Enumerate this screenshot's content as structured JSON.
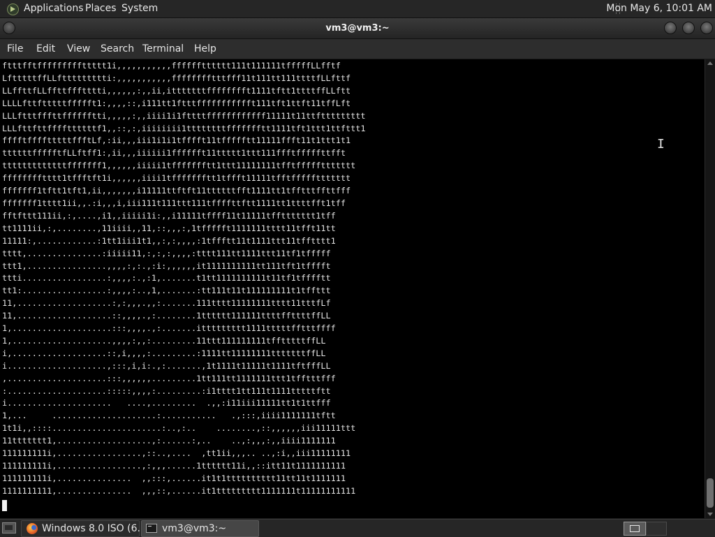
{
  "top_panel": {
    "menus": [
      "Applications",
      "Places",
      "System"
    ],
    "clock": "Mon May  6, 10:01 AM"
  },
  "window": {
    "title": "vm3@vm3:~"
  },
  "terminal_menu": [
    "File",
    "Edit",
    "View",
    "Search",
    "Terminal",
    "Help"
  ],
  "terminal": {
    "lines": [
      "ftttfftfffffffffttttt1i,,,,,,,,,,,fffffftttttt111t111111tfffffLLfftf",
      "LftttttffLLfttttttttti:,,,,,,,,,,,fffffffftttfff11t111tt111ttttfLLfttf",
      "LLffttfLLffttffftttti,,,,,,:,,ii,itttttttfffffffft1111tftt1ttttffLLftt",
      "LLLLfttftttttffffft1:,,,,::,i111tt1ftttffffffffffft111tft1ttft11tffLft",
      "LLLftttfffttfffffftti,,,,,:,,iiii1i1fttttffffffffffff11111t11ttfttttttttt",
      "LLLfttfttffffttttttf1,,::,:,iiiiiiii1ttttttttffffffftt1111tft1ttt1ttfttt1",
      "fffftfffftttttffftLf,:ii,,,iii1i1i1tfffft11tffffftt11111ffft11t1ttt1t1",
      "ttttttffffftfLLftff1:,ii,,,iiiiii1fffffft11ttttt1ttt111ffftfffffttfft",
      "tttttttttttttfffffff1,,,,,,iiiii1tffffffftt1ttt11111111tfftfffffttttttt",
      "fffffffftttt1tffftft1i,,,,,,iiii1tffffffftt1tffft11111tfftfffffttttttt",
      "fffffff1tftt1tft1,ii,,,,,,,i11111ttftft11ttttttfft1111tt1tfftttffttfff",
      "fffffff1tttt1ii,,.:i,,,i,iii111t111ttt111tffffttftt1111tt1ttttfft1tff",
      "fftfttt111ii,:,....,i1,,iiiii1i:,,i11111tffff11t11111tffttttttt1tff",
      "tt1111ii,:,........,11iiii,,11,::,,,:,1tffffft1111111tttt11tfft11tt",
      "11111:,............:1tt1iii1t1,,:,:,,,,:1tffftt11t1111ttt11tfftttt1",
      "tttt,...............:iiiii11,:,:,:,,,,:tttt111tt1111ttt11tf1tfffff",
      "ttt1,................,,,,:,:.,:i:,,,,,,it1111111111tt111tft1tfffft",
      "ttti.................:,,,,:.,:1,.......t1tt1111111111t11tf1tfffftt",
      "tt1:.................:,,,,:..,1,.......:tt111t11t111111111t1tffttt",
      "11,...................:,:,,,.,,:.......111tttt11111111tttt11tttfLf",
      "11,...................::,,,,.,:........1tttttt111111ttttffttttffLL",
      "1,....................:::,,,,.,:.......ittttttttt1111tttttfftttffff",
      "1,....................,,,,:,,:.........11ttt111111111tfftttttffLL",
      "i,...................::,i,,,,:.........:1111tt11111111tttttttffLL",
      "i....................,:::,i,i:.,:.......,1t1111t11111t1111tftfffLL",
      ",....................:::,,,,,,.........1tt111tt1111111ttt1tfftttfff",
      ":....................:::::,,,,:.........:i1tttt1tt111t1111tttttftt",
      "i.....................   ....,.........  .,,:i11iii11111tt1t1ttfff",
      "1,...     .....................:...........   .,:::,iiii1111111tftt",
      "1t1i,,::::......................:..,:..    ........,::,,,,,,iii11111ttt",
      "11ttttttt1,...................,:......:,..    ..,:,,,:,,iiii1111111",
      "111111111i,.................,::..,....  ,tt1ii,,,.. ..,:i,,iii11111111",
      "111111111i,.................,:,,,......1tttttt11i,,::itt11t1111111111",
      "111111111i,...............  ,,:::,......it1t1tttttttttt11tt11t1111111",
      "1111111111,...............  ,,,::,......it1ttttttttt1111111t11111111111"
    ]
  }
}
